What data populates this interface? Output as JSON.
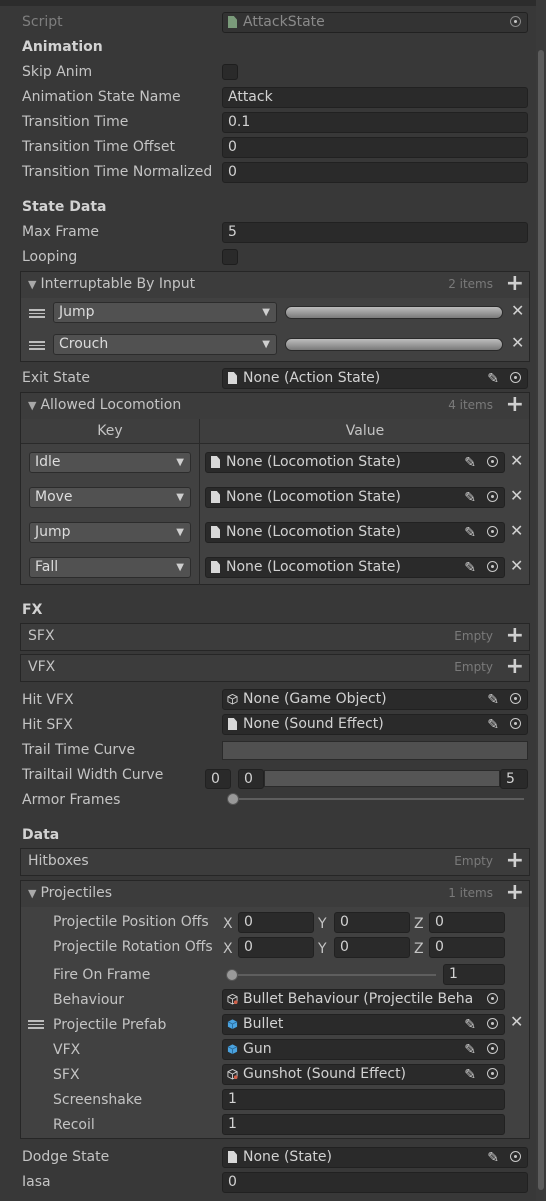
{
  "script": {
    "label": "Script",
    "value": "AttackState"
  },
  "animation": {
    "header": "Animation",
    "skip_anim": "Skip Anim",
    "state_name_label": "Animation State Name",
    "state_name_value": "Attack",
    "transition_time_label": "Transition Time",
    "transition_time_value": "0.1",
    "transition_offset_label": "Transition Time Offset",
    "transition_offset_value": "0",
    "transition_norm_label": "Transition Time Normalized",
    "transition_norm_value": "0"
  },
  "state_data": {
    "header": "State Data",
    "max_frame_label": "Max Frame",
    "max_frame_value": "5",
    "looping_label": "Looping",
    "interruptable": {
      "title": "Interruptable By Input",
      "count": "2 items",
      "items": [
        "Jump",
        "Crouch"
      ]
    },
    "exit_state_label": "Exit State",
    "exit_state_value": "None (Action State)",
    "locomotion": {
      "title": "Allowed Locomotion",
      "count": "4 items",
      "key_header": "Key",
      "value_header": "Value",
      "rows": [
        {
          "key": "Idle",
          "value": "None (Locomotion State)"
        },
        {
          "key": "Move",
          "value": "None (Locomotion State)"
        },
        {
          "key": "Jump",
          "value": "None (Locomotion State)"
        },
        {
          "key": "Fall",
          "value": "None (Locomotion State)"
        }
      ]
    }
  },
  "fx": {
    "header": "FX",
    "sfx_title": "SFX",
    "sfx_empty": "Empty",
    "vfx_title": "VFX",
    "vfx_empty": "Empty",
    "hit_vfx_label": "Hit VFX",
    "hit_vfx_value": "None (Game Object)",
    "hit_sfx_label": "Hit SFX",
    "hit_sfx_value": "None (Sound Effect)",
    "trail_time_label": "Trail Time Curve",
    "trail_width_label": "Trailtail Width Curve",
    "trail_width_min_a": "0",
    "trail_width_min_b": "0",
    "trail_width_max": "5",
    "armor_label": "Armor Frames"
  },
  "data": {
    "header": "Data",
    "hitboxes_title": "Hitboxes",
    "hitboxes_empty": "Empty",
    "projectiles": {
      "title": "Projectiles",
      "count": "1 items",
      "pos_label": "Projectile Position Offs",
      "rot_label": "Projectile Rotation Offs",
      "pos": {
        "x": "0",
        "y": "0",
        "z": "0"
      },
      "rot": {
        "x": "0",
        "y": "0",
        "z": "0"
      },
      "fire_label": "Fire On Frame",
      "fire_value": "1",
      "behaviour_label": "Behaviour",
      "behaviour_value": "Bullet Behaviour (Projectile Beha",
      "prefab_label": "Projectile Prefab",
      "prefab_value": "Bullet",
      "vfx_label": "VFX",
      "vfx_value": "Gun",
      "sfx_label": "SFX",
      "sfx_value": "Gunshot (Sound Effect)",
      "screenshake_label": "Screenshake",
      "screenshake_value": "1",
      "recoil_label": "Recoil",
      "recoil_value": "1"
    }
  },
  "dodge_state_label": "Dodge State",
  "dodge_state_value": "None (State)",
  "iasa_label": "Iasa",
  "iasa_value": "0",
  "xyz_labels": {
    "x": "X",
    "y": "Y",
    "z": "Z"
  }
}
